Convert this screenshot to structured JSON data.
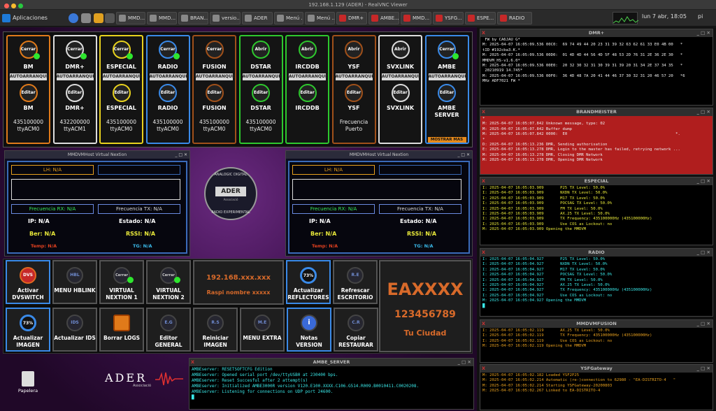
{
  "vnc_title": "192.168.1.129 (ADER) - RealVNC Viewer",
  "taskbar": {
    "menu": "Aplicaciones",
    "tasks": [
      "MMD...",
      "MMD...",
      "BRAN...",
      "versio...",
      "ADER",
      "Menú ...",
      "Menú ...",
      "DMR+",
      "AMBE...",
      "MMD...",
      "YSFG...",
      "ESPE...",
      "RADIO"
    ],
    "clock": "lun  7 abr, 18:05",
    "user": "pi"
  },
  "top_buttons": [
    {
      "name": "BM",
      "action": "Cerrar",
      "edit": "Editar",
      "name2": "BM",
      "freq": "435100000",
      "port": "ttyACM0",
      "active": true,
      "color": "#e07a1a"
    },
    {
      "name": "DMR+",
      "action": "Cerrar",
      "edit": "Editar",
      "name2": "DMR+",
      "freq": "432200000",
      "port": "ttyACM1",
      "active": true,
      "color": "#dddddd"
    },
    {
      "name": "ESPECIAL",
      "action": "Cerrar",
      "edit": "Editar",
      "name2": "ESPECIAL",
      "freq": "435100000",
      "port": "ttyACM0",
      "active": true,
      "color": "#e8d21e"
    },
    {
      "name": "RADIO",
      "action": "Cerrar",
      "edit": "Editar",
      "name2": "RADIO",
      "freq": "435100000",
      "port": "ttyACM0",
      "active": true,
      "color": "#3a8ae8"
    },
    {
      "name": "FUSION",
      "action": "Cerrar",
      "edit": "Editar",
      "name2": "FUSION",
      "freq": "435100000",
      "port": "ttyACM0",
      "active": false,
      "color": "#a0501a"
    },
    {
      "name": "DSTAR",
      "action": "Abrir",
      "edit": "Editar",
      "name2": "DSTAR",
      "freq": "435100000",
      "port": "ttyACM0",
      "active": false,
      "color": "#2ec82e"
    },
    {
      "name": "IRCDDB",
      "action": "Abrir",
      "edit": "Editar",
      "name2": "IRCDDB",
      "freq": "",
      "port": "",
      "active": false,
      "color": "#2ec82e"
    },
    {
      "name": "YSF",
      "action": "Abrir",
      "edit": "Editar",
      "name2": "YSF",
      "freq": "Frecuencia",
      "port": "Puerto",
      "active": false,
      "color": "#a0501a"
    },
    {
      "name": "SVXLINK",
      "action": "Abrir",
      "edit": "Editar",
      "name2": "SVXLINK",
      "freq": "",
      "port": "",
      "active": false,
      "color": "#dddddd"
    },
    {
      "name": "AMBE",
      "action": "Cerrar",
      "edit": "Editar",
      "name2": "AMBE SERVER",
      "freq": "",
      "port": "",
      "active": true,
      "color": "#3a8ae8"
    }
  ],
  "autoarranque": "AUTOARRANQUE",
  "mostrar_mas": "MOSTRAR MAS",
  "nextion_title": "MMDVMHost Virtual Nextion",
  "nextion": {
    "lh": "LH: N/A",
    "rx": "Frecuencia RX: N/A",
    "tx": "Frecuencia TX: N/A",
    "ip": "IP: N/A",
    "estado": "Estado: N/A",
    "ber": "Ber: N/A",
    "rssi": "RSSI: N/A",
    "temp": "Temp: N/A",
    "tg": "TG: N/A"
  },
  "logo": {
    "top": "ANALOGIC  DIGITAL",
    "bottom": "RADIO   EXPERIMENTAL",
    "center": "ADER",
    "sub": "Associació"
  },
  "tiles_row1": [
    {
      "icon": "DVS",
      "label": "Activar DVSWITCH"
    },
    {
      "icon": "HBL",
      "label": "MENU HBLINK"
    },
    {
      "icon": "Cerrar",
      "label": "VIRTUAL NEXTION 1"
    },
    {
      "icon": "Cerrar",
      "label": "VIRTUAL NEXTION 2"
    }
  ],
  "tiles_row1b": [
    {
      "icon": "73%",
      "label": "Actualizar REFLECTORES"
    },
    {
      "icon": "R.E",
      "label": "Refrescar ESCRITORIO"
    }
  ],
  "tiles_row2": [
    {
      "icon": "73%",
      "label": "Actualizar IMAGEN"
    },
    {
      "icon": "IDS",
      "label": "Actualizar IDS"
    },
    {
      "icon": "",
      "label": "Borrar LOGS"
    },
    {
      "icon": "E.G",
      "label": "Editor GENERAL"
    },
    {
      "icon": "R.S",
      "label": "Reiniciar IMAGEN"
    },
    {
      "icon": "M.E",
      "label": "MENU EXTRA"
    },
    {
      "icon": "i",
      "label": "Notas VERSION"
    },
    {
      "icon": "C.R",
      "label": "Copiar RESTAURAR"
    }
  ],
  "ipbox": {
    "ip": "192.168.xxx.xxx",
    "name": "Raspi nombre xxxxx"
  },
  "callbox": {
    "call": "EAXXXX",
    "id": "123456789",
    "city": "Tu Ciudad"
  },
  "trash": "Papelera",
  "ader_logo": {
    "name": "ADER",
    "sub": "Associació"
  },
  "terminals": [
    {
      "title": "DMR+",
      "color": "#eeeeee",
      "bg": "#000000",
      "lines": [
        " FW by CA6JAU G*",
        "M: 2025-04-07 16:05:09.536 00C0:  69 74 49 44 20 23 31 39 32 63 62 61 33 E0 4B 00   *",
        "tID #192cba3.K.*",
        "M: 2025-04-07 16:05:09.536 00D0:  01 4D 4D 44 56 4D 5F 48 53 2D 76 31 2E 36 2E 30   *",
        "MMDVM_HS-v1.6.0*",
        "M: 2025-04-07 16:05:09.536 00E0:  20 32 30 32 31 30 39 31 39 20 31 34 2E 37 34 35   *",
        " 20210919 14.745*",
        "M: 2025-04-07 16:05:09.536 00F0:  36 4D 48 7A 20 41 44 46 37 30 32 31 20 46 57 20   *6",
        "MHz ADF7021 FW *"
      ]
    },
    {
      "title": "BRANDMEISTER",
      "color": "#eeeeee",
      "bg": "#b01e1e",
      "lines": [
        "*",
        "M: 2025-04-07 16:05:07.842 Unknown message, type: 02",
        "M: 2025-04-07 16:05:07.842 Buffer dump",
        "M: 2025-04-07 16:05:07.842 0000:  E0                                              *.",
        "*",
        "D: 2025-04-07 16:05:13.236 DMR, Sending authorisation",
        "E: 2025-04-07 16:05:13.278 DMR, Login to the master has failed, retrying network ...",
        "M: 2025-04-07 16:05:13.278 DMR, Closing DMR Network",
        "M: 2025-04-07 16:05:13.278 DMR, Opening DMR Network"
      ]
    },
    {
      "title": "ESPECIAL",
      "color": "#e8e83a",
      "bg": "#000000",
      "lines": [
        "I: 2025-04-07 16:05:03.909       P25 TX Level: 50.0%",
        "I: 2025-04-07 16:05:03.909       NXDN TX Level: 50.0%",
        "I: 2025-04-07 16:05:03.909       M17 TX Level: 50.0%",
        "I: 2025-04-07 16:05:03.909       POCSAG TX Level: 50.0%",
        "I: 2025-04-07 16:05:03.909       FM TX Level: 50.0%",
        "I: 2025-04-07 16:05:03.909       AX.25 TX Level: 50.0%",
        "I: 2025-04-07 16:05:03.909       TX Frequency: 435100000Hz (435100000Hz)",
        "I: 2025-04-07 16:05:03.909       Use COS as Lockout: no",
        "M: 2025-04-07 16:05:03.909 Opening the MMDVM"
      ]
    },
    {
      "title": "RADIO",
      "color": "#3ae8e8",
      "bg": "#000000",
      "lines": [
        "I: 2025-04-07 16:05:04.927       P25 TX Level: 50.0%",
        "I: 2025-04-07 16:05:04.927       NXDN TX Level: 50.0%",
        "I: 2025-04-07 16:05:04.927       M17 TX Level: 50.0%",
        "I: 2025-04-07 16:05:04.927       POCSAG TX Level: 50.0%",
        "I: 2025-04-07 16:05:04.927       FM TX Level: 50.0%",
        "I: 2025-04-07 16:05:04.927       AX.25 TX Level: 50.0%",
        "I: 2025-04-07 16:05:04.927       TX Frequency: 435100000Hz (435100000Hz)",
        "I: 2025-04-07 16:05:04.927       Use COS as Lockout: no",
        "M: 2025-04-07 16:05:04.927 Opening the MMDVM",
        "█"
      ]
    },
    {
      "title": "MMDVMFUSION",
      "color": "#e8a01e",
      "bg": "#000000",
      "lines": [
        "I: 2025-04-07 16:05:02.119       AX.25 TX Level: 50.0%",
        "I: 2025-04-07 16:05:02.119       TX Frequency: 435100000Hz (435100000Hz)",
        "I: 2025-04-07 16:05:02.119       Use COS as Lockout: no",
        "M: 2025-04-07 16:05:02.119 Opening the MMDVM"
      ]
    },
    {
      "title": "YSFGateway",
      "color": "#e8a01e",
      "bg": "#000000",
      "lines": [
        "M: 2025-04-07 16:05:02.182 Loaded YSF2P25",
        "M: 2025-04-07 16:05:02.214 Automatic (re-)connection to 62980 - \"EA-DISTRITO-4   \"",
        "M: 2025-04-07 16:05:02.214 Starting YSFGateway-20200803",
        "M: 2025-04-07 16:05:02.267 Linked to EA-DISTRITO-4"
      ]
    }
  ],
  "ambe": {
    "title": "AMBE_SERVER",
    "lines": [
      "AMBEserver: RESETSOFTCFG Edition",
      "AMBEserver: Opened serial port /dev/ttyUSB0 at 230400 bps.",
      "AMBEserver: Reset Succesful after 2 attempt(s)",
      "AMBEserver: Initialized AMBE3000R version V120.E100.XXXX.C106.G514.R009.B0010411.C0020208.",
      "AMBEserver: Listening for connections on UDP port 24600.",
      "█"
    ]
  }
}
